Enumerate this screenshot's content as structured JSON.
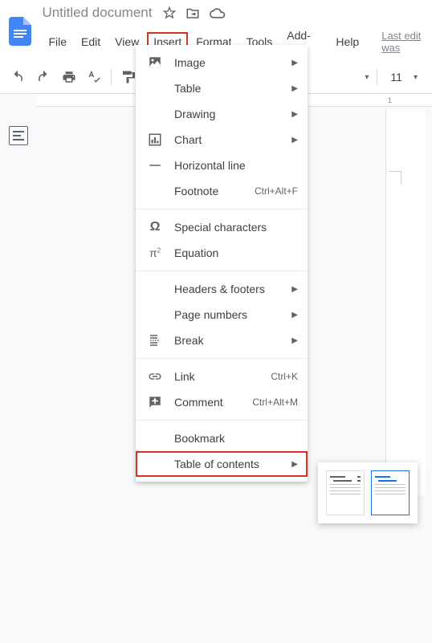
{
  "header": {
    "title": "Untitled document"
  },
  "menubar": {
    "items": [
      "File",
      "Edit",
      "View",
      "Insert",
      "Format",
      "Tools",
      "Add-ons",
      "Help"
    ],
    "last_edit": "Last edit was"
  },
  "toolbar": {
    "font_size": "11"
  },
  "ruler": {
    "mark": "1"
  },
  "dropdown": {
    "items": [
      {
        "label": "Image",
        "has_arrow": true,
        "icon": "image"
      },
      {
        "label": "Table",
        "has_arrow": true,
        "icon": "blank"
      },
      {
        "label": "Drawing",
        "has_arrow": true,
        "icon": "blank"
      },
      {
        "label": "Chart",
        "has_arrow": true,
        "icon": "chart"
      },
      {
        "label": "Horizontal line",
        "icon": "hline"
      },
      {
        "label": "Footnote",
        "shortcut": "Ctrl+Alt+F",
        "icon": "blank"
      },
      {
        "divider": true
      },
      {
        "label": "Special characters",
        "icon": "omega"
      },
      {
        "label": "Equation",
        "icon": "pi"
      },
      {
        "divider": true
      },
      {
        "label": "Headers & footers",
        "has_arrow": true,
        "icon": "blank"
      },
      {
        "label": "Page numbers",
        "has_arrow": true,
        "icon": "blank"
      },
      {
        "label": "Break",
        "has_arrow": true,
        "icon": "break"
      },
      {
        "divider": true
      },
      {
        "label": "Link",
        "shortcut": "Ctrl+K",
        "icon": "link"
      },
      {
        "label": "Comment",
        "shortcut": "Ctrl+Alt+M",
        "icon": "comment"
      },
      {
        "divider": true
      },
      {
        "label": "Bookmark",
        "icon": "blank"
      },
      {
        "label": "Table of contents",
        "has_arrow": true,
        "icon": "blank",
        "boxed": true
      }
    ]
  }
}
